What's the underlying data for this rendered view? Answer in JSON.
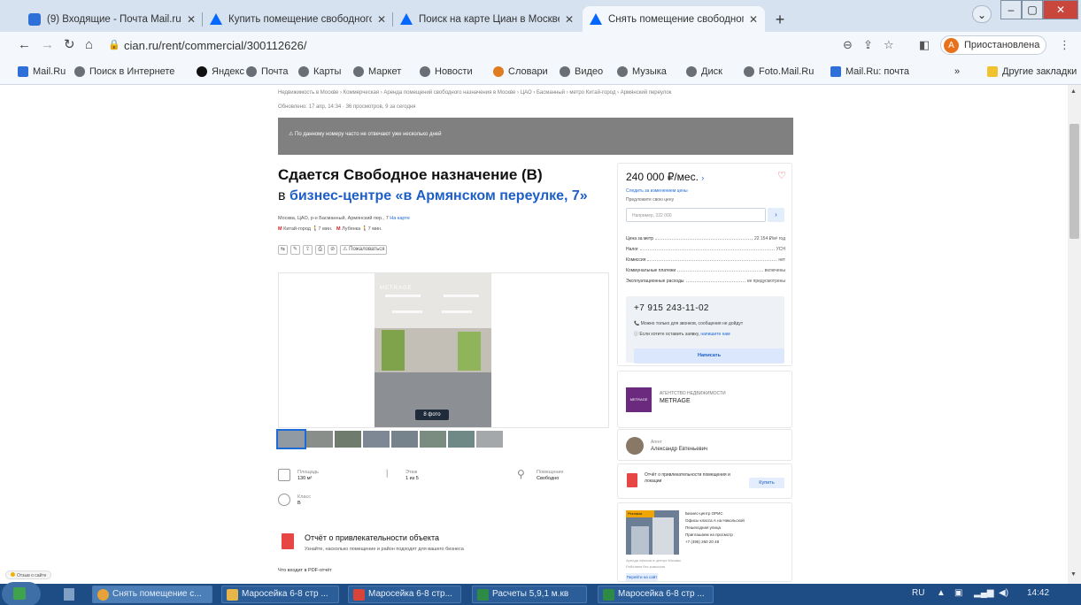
{
  "browser": {
    "tabs": [
      {
        "title": "(9) Входящие - Почта Mail.ru",
        "favicon": "mail-icon"
      },
      {
        "title": "Купить помещение свободного",
        "favicon": "cian-icon"
      },
      {
        "title": "Поиск на карте Циан в Москве",
        "favicon": "cian-icon"
      },
      {
        "title": "Снять помещение свободного",
        "favicon": "cian-icon",
        "active": true
      }
    ],
    "new_tab": "+",
    "url": "cian.ru/rent/commercial/300112626/",
    "profile_avatar": "А",
    "profile_label": "Приостановлена",
    "bookmarks": [
      "Mail.Ru",
      "Поиск в Интернете",
      "Яндекс",
      "Почта",
      "Карты",
      "Маркет",
      "Новости",
      "Словари",
      "Видео",
      "Музыка",
      "Диск",
      "Foto.Mail.Ru",
      "Mail.Ru: почта"
    ],
    "bookmarks_overflow": "»",
    "other_bookmarks": "Другие закладки"
  },
  "listing": {
    "breadcrumbs": "Недвижимость в Москве › Коммерческая › Аренда помещений свободного назначения в Москве › ЦАО › Басманный › метро Китай-город › Армянский переулок",
    "updated": "Обновлено: 17 апр, 14:34 · 36 просмотров, 9 за сегодня",
    "banner_text": "⚠ По данному номеру часто не отвечают уже несколько дней",
    "title": "Сдается Свободное назначение (B)",
    "subtitle_prefix": "в ",
    "subtitle_link": "бизнес-центре «в Армянском переулке, 7»",
    "address": "Москва, ЦАО, р-н Басманный, Армянский пер., 7",
    "address_map_link": "На карте",
    "metro_1": "Китай-город",
    "metro_1_time": "7 мин.",
    "metro_2": "Лубянка",
    "metro_2_time": "7 мин.",
    "complain": "⚠ Пожаловаться",
    "photo_watermark": "METRAGE",
    "photo_count": "8 фото",
    "features": [
      {
        "label": "Площадь",
        "value": "130 м²",
        "icon": "area-icon"
      },
      {
        "label": "Этаж",
        "value": "1 из 5",
        "icon": "stairs-icon"
      },
      {
        "label": "Помещение",
        "value": "Свободно",
        "icon": "key-icon"
      },
      {
        "label": "Класс",
        "value": "B",
        "icon": "class-icon"
      }
    ],
    "report_title": "Отчёт о привлекательности объекта",
    "report_text": "Узнайте, насколько помещение и район подходят для вашего бизнеса",
    "note": "Что входит в PDF-отчёт"
  },
  "sidebar": {
    "price": "240 000 ₽/мес.",
    "price_arrow": "›",
    "price_change_link": "Следить за изменением цены",
    "offer_label": "Предложите свою цену",
    "price_input_placeholder": "Например, 222 000",
    "details": [
      {
        "label": "Цена за метр",
        "value": "22 154 ₽/м² год"
      },
      {
        "label": "Налог",
        "value": "УСН"
      },
      {
        "label": "Комиссия",
        "value": "нет"
      },
      {
        "label": "Коммунальные платежи",
        "value": "включены"
      },
      {
        "label": "Эксплуатационные расходы",
        "value": "не предусмотрены"
      }
    ],
    "phone": "+7 915 243-11-02",
    "phone_note_1": "Можно только для звонков, сообщения не дойдут",
    "phone_note_2": "Если хотите оставить заявку,",
    "phone_note_2_link": "напишите нам",
    "write_button": "Написать",
    "agency_type": "АГЕНТСТВО НЕДВИЖИМОСТИ",
    "agency_name": "METRAGE",
    "agency_logo": "METRAGE",
    "agent_label": "Агент",
    "agent_name": "Александр Евтеньевич",
    "report_card_text": "Отчёт о привлекательности помещения и локации",
    "buy_button": "Купить",
    "ad_tag": "Реклама",
    "ad_lines": [
      "Бизнес-центр ОРИС",
      "Офисы класса А на Никольской",
      "Пешеходная улица",
      "Приглашаем на просмотр",
      "+7 (495) 260 20 48"
    ],
    "ad_sub_1": "Аренда офисов в центре Москвы",
    "ad_sub_2": "Работаем без комиссии",
    "ad_button": "Перейти на сайт"
  },
  "feedback_label": "Отзыв о сайте",
  "taskbar": {
    "items": [
      {
        "label": "Снять помещение с...",
        "icon": "chrome-icon",
        "color": "#e8a23a",
        "active": true
      },
      {
        "label": "Маросейка 6-8 стр ...",
        "icon": "folder-icon",
        "color": "#e6b64b"
      },
      {
        "label": "Маросейка 6-8 стр...",
        "icon": "pdf-icon",
        "color": "#d9443a"
      },
      {
        "label": "Расчеты 5,9,1 м.кв",
        "icon": "excel-icon",
        "color": "#2e8b46"
      },
      {
        "label": "Маросейка 6-8 стр ...",
        "icon": "excel-icon",
        "color": "#2e8b46"
      }
    ],
    "lang": "RU",
    "time": "14:42"
  }
}
